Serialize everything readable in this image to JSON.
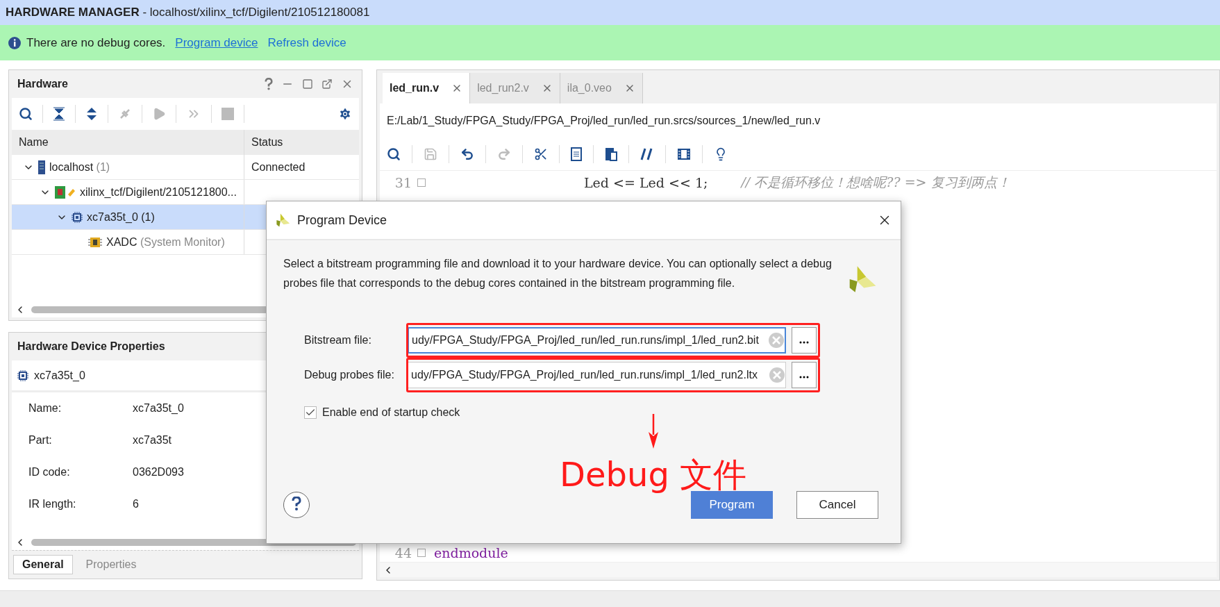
{
  "window": {
    "title": "**HARDWARE MANAGER** - localhost/xilinx_tcf/Digilent/210512180081"
  },
  "banner": {
    "message": "There are no debug cores.",
    "links": [
      {
        "label": "Program device",
        "underlined": true
      },
      {
        "label": "Refresh device",
        "underlined": false
      }
    ]
  },
  "hardware_panel": {
    "title": "Hardware",
    "columns": [
      "Name",
      "Status"
    ],
    "tree": [
      {
        "kind": "server",
        "name": "localhost",
        "count": "(1)",
        "status": "Connected",
        "expanded": true,
        "selected": false,
        "children": [
          {
            "kind": "board",
            "name": "xilinx_tcf/Digilent/2105121800...",
            "expanded": true,
            "selected": false,
            "children": [
              {
                "kind": "chip",
                "name": "xc7a35t_0 (1)",
                "expanded": true,
                "selected": true,
                "children": [
                  {
                    "kind": "adc",
                    "name": "XADC",
                    "count": "(System Monitor)",
                    "selected": false
                  }
                ]
              }
            ]
          }
        ]
      }
    ]
  },
  "properties_panel": {
    "title": "Hardware Device Properties",
    "device": "xc7a35t_0",
    "properties": [
      {
        "label": "Name:",
        "value": "xc7a35t_0"
      },
      {
        "label": "Part:",
        "value": "xc7a35t"
      },
      {
        "label": "ID code:",
        "value": "0362D093"
      },
      {
        "label": "IR length:",
        "value": "6"
      }
    ],
    "tabs": [
      {
        "label": "General",
        "selected": true
      },
      {
        "label": "Properties",
        "selected": false
      }
    ]
  },
  "editor": {
    "tabs": [
      {
        "label": "led_run.v",
        "selected": true
      },
      {
        "label": "led_run2.v",
        "selected": false
      },
      {
        "label": "ila_0.veo",
        "selected": false
      }
    ],
    "path": "E:/Lab/1_Study/FPGA_Study/FPGA_Proj/led_run/led_run.srcs/sources_1/new/led_run.v",
    "lines": [
      {
        "number": "31",
        "code": "Led <= Led << 1;",
        "comment": "// 不是循环移位！想啥呢?? => 复习到两点！",
        "kind": "statement"
      },
      {
        "number": "44",
        "code": "endmodule",
        "kind": "keyword"
      }
    ]
  },
  "dialog": {
    "title": "Program Device",
    "description": "Select a bitstream programming file and download it to your hardware device. You can optionally select a debug probes file that corresponds to the debug cores contained in the bitstream programming file.",
    "fields": [
      {
        "label": "Bitstream file:",
        "value": "udy/FPGA_Study/FPGA_Proj/led_run/led_run.runs/impl_1/led_run2.bit",
        "focused": true
      },
      {
        "label": "Debug probes file:",
        "value": "udy/FPGA_Study/FPGA_Proj/led_run/led_run.runs/impl_1/led_run2.ltx",
        "focused": false
      }
    ],
    "checkbox": {
      "label": "Enable end of startup check",
      "checked": true
    },
    "buttons": [
      {
        "label": "Program",
        "kind": "primary"
      },
      {
        "label": "Cancel",
        "kind": "secondary"
      }
    ]
  },
  "annotation": {
    "text": "Debug 文件"
  }
}
